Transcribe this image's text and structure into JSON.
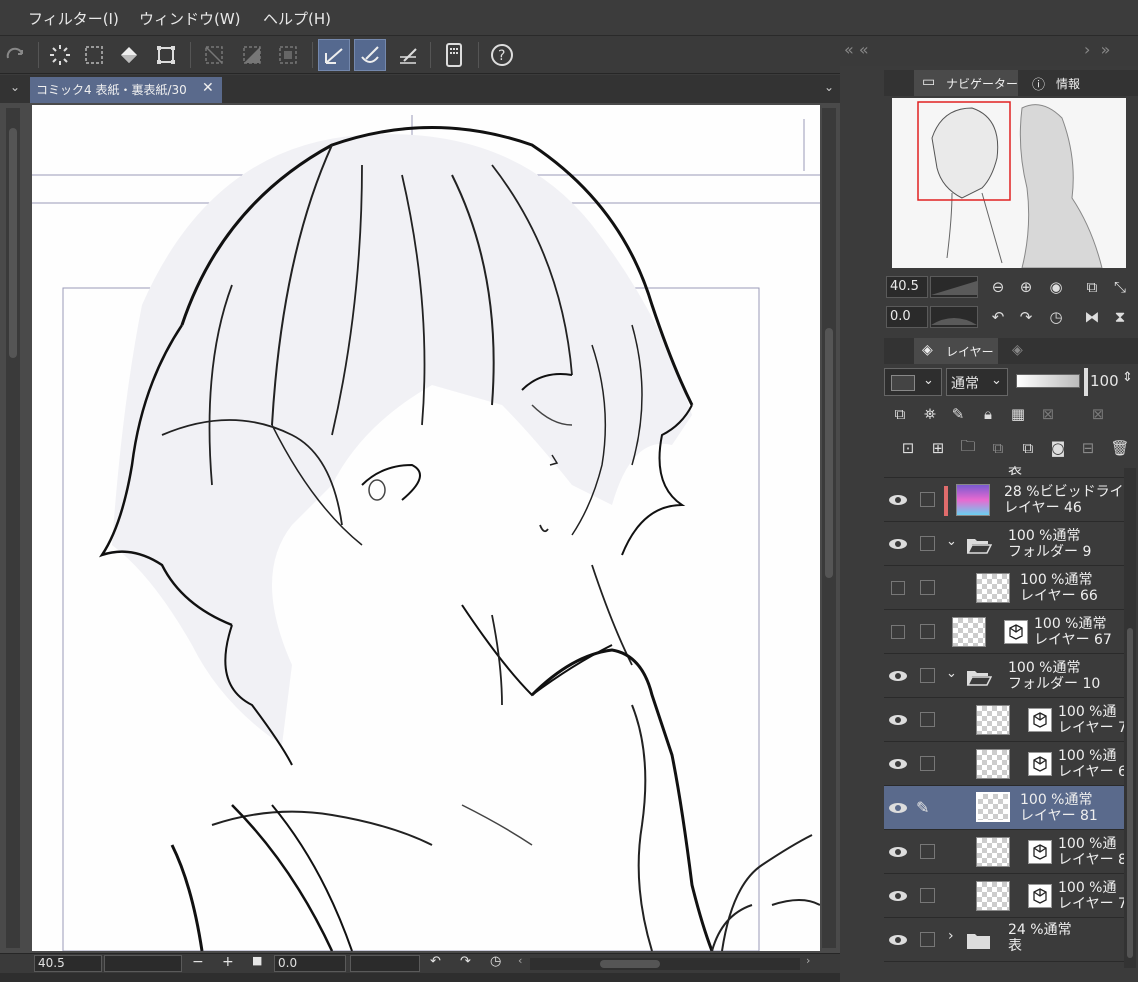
{
  "menu": {
    "items": [
      {
        "label": "フィルター(I)"
      },
      {
        "label": "ウィンドウ(W)"
      },
      {
        "label": "ヘルプ(H)"
      }
    ]
  },
  "document": {
    "tab_title": "コミック4 表紙・裏表紙/30"
  },
  "statusbar": {
    "zoom": "40.5",
    "rotation": "0.0"
  },
  "navigator": {
    "tab_label": "ナビゲーター",
    "info_tab_label": "情報",
    "zoom_value": "40.5",
    "rotation_value": "0.0"
  },
  "layers_panel": {
    "tab_label": "レイヤー",
    "blend_mode": "通常",
    "opacity": "100",
    "partial_top_label": "表",
    "layers": [
      {
        "percent": "28 %",
        "mode": "ビビッドライト",
        "name": "レイヤー 46",
        "visible": true,
        "type": "gradient"
      },
      {
        "percent": "100 %",
        "mode": "通常",
        "name": "フォルダー 9",
        "visible": true,
        "type": "folder-open"
      },
      {
        "percent": "100 %",
        "mode": "通常",
        "name": "レイヤー 66",
        "visible": false,
        "type": "raster"
      },
      {
        "percent": "100 %",
        "mode": "通常",
        "name": "レイヤー 67",
        "visible": false,
        "type": "raster-3d"
      },
      {
        "percent": "100 %",
        "mode": "通常",
        "name": "フォルダー 10",
        "visible": true,
        "type": "folder-open"
      },
      {
        "percent": "100 %",
        "mode": "通",
        "name": "レイヤー 7",
        "visible": true,
        "type": "raster-3d-child"
      },
      {
        "percent": "100 %",
        "mode": "通",
        "name": "レイヤー 6",
        "visible": true,
        "type": "raster-3d-child"
      },
      {
        "percent": "100 %",
        "mode": "通常",
        "name": "レイヤー 81",
        "visible": true,
        "type": "selected"
      },
      {
        "percent": "100 %",
        "mode": "通",
        "name": "レイヤー 8",
        "visible": true,
        "type": "raster-3d-child"
      },
      {
        "percent": "100 %",
        "mode": "通",
        "name": "レイヤー 7",
        "visible": true,
        "type": "raster-3d-child"
      },
      {
        "percent": "24 %",
        "mode": "通常",
        "name": "表",
        "visible": true,
        "type": "folder-closed"
      }
    ]
  },
  "colors": {
    "accent": "#5a6a8c",
    "panel_bg": "#3b3b3b",
    "color_tag": "#e06c6c"
  }
}
